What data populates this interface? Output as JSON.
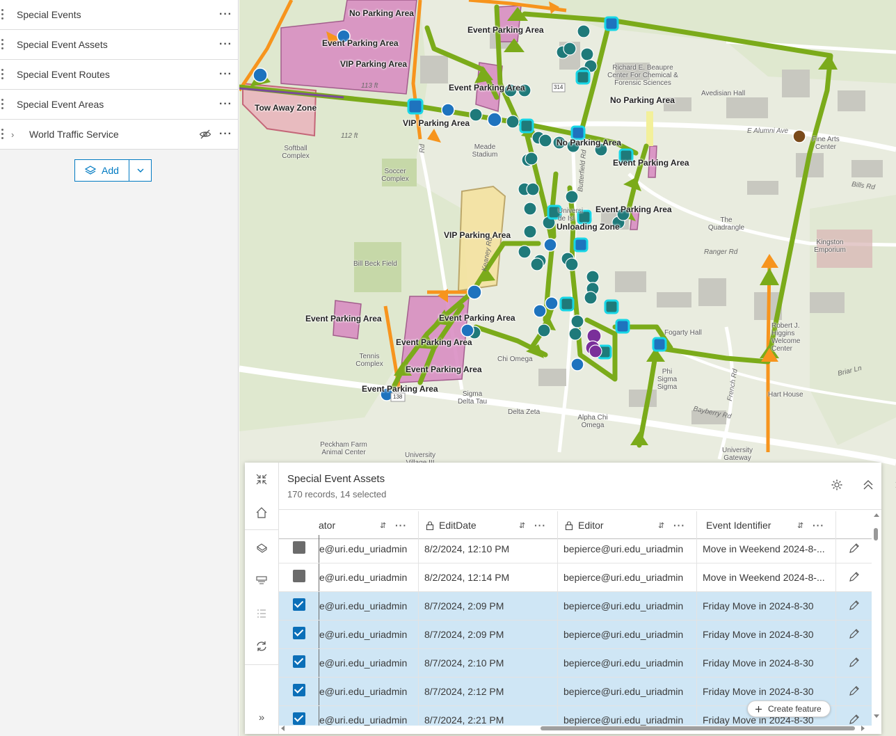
{
  "layers": {
    "items": [
      {
        "label": "Special Events"
      },
      {
        "label": "Special Event Assets"
      },
      {
        "label": "Special Event Routes"
      },
      {
        "label": "Special Event Areas"
      },
      {
        "label": "World Traffic Service",
        "hidden": true
      }
    ],
    "add_label": "Add"
  },
  "map": {
    "area_labels": [
      "No Parking Area",
      "Event Parking Area",
      "VIP Parking Area",
      "Event Parking Area",
      "Tow Away Zone",
      "VIP Parking Area",
      "No Parking Area",
      "No Parking Area",
      "Event Parking Area",
      "Event Parking Area",
      "Unloading Zone",
      "VIP Parking Area",
      "Event Parking Area",
      "Event Parking Area",
      "Event Parking Area",
      "Event Parking Area",
      "Event Parking Area",
      "Event Parking Area"
    ],
    "places": [
      "Softball Complex",
      "Meade Stadium",
      "Soccer Complex",
      "Bill Beck Field",
      "Tennis Complex",
      "Chi Omega",
      "Sigma Delta Tau",
      "Delta Zeta",
      "Alpha Chi Omega",
      "Peckham Farm Animal Center",
      "University Village III",
      "Richard E. Beaupre Center For Chemical & Forensic Sciences",
      "Avedisian Hall",
      "Fine Arts Center",
      "The Quadrangle",
      "Kingston Emporium",
      "Fogarty Hall",
      "Robert J. Higgins Welcome Center",
      "Phi Sigma Sigma",
      "Hart House",
      "University Gateway",
      "Universi de Isl"
    ],
    "roads": [
      "E Alumni Ave",
      "Bills Rd",
      "Ranger Rd",
      "Briar Ln",
      "Bayberry Rd",
      "French Rd",
      "Butterfield Rd",
      "Keaney Rd"
    ],
    "elevations": [
      "113 ft",
      "112 ft"
    ],
    "shields": [
      "314",
      "138",
      "Rd"
    ]
  },
  "table": {
    "title": "Special Event Assets",
    "subtitle": "170 records, 14 selected",
    "columns": [
      {
        "label": "ator",
        "locked": false
      },
      {
        "label": "EditDate",
        "locked": true
      },
      {
        "label": "Editor",
        "locked": true
      },
      {
        "label": "Event Identifier",
        "locked": false
      }
    ],
    "rows": [
      {
        "selected": false,
        "creator": "e@uri.edu_uriadmin",
        "edit_date": "8/2/2024, 12:10 PM",
        "editor": "bepierce@uri.edu_uriadmin",
        "event": "Move in Weekend 2024-8-..."
      },
      {
        "selected": false,
        "creator": "e@uri.edu_uriadmin",
        "edit_date": "8/2/2024, 12:14 PM",
        "editor": "bepierce@uri.edu_uriadmin",
        "event": "Move in Weekend 2024-8-..."
      },
      {
        "selected": true,
        "creator": "e@uri.edu_uriadmin",
        "edit_date": "8/7/2024, 2:09 PM",
        "editor": "bepierce@uri.edu_uriadmin",
        "event": "Friday Move in 2024-8-30"
      },
      {
        "selected": true,
        "creator": "e@uri.edu_uriadmin",
        "edit_date": "8/7/2024, 2:09 PM",
        "editor": "bepierce@uri.edu_uriadmin",
        "event": "Friday Move in 2024-8-30"
      },
      {
        "selected": true,
        "creator": "e@uri.edu_uriadmin",
        "edit_date": "8/7/2024, 2:10 PM",
        "editor": "bepierce@uri.edu_uriadmin",
        "event": "Friday Move in 2024-8-30"
      },
      {
        "selected": true,
        "creator": "e@uri.edu_uriadmin",
        "edit_date": "8/7/2024, 2:12 PM",
        "editor": "bepierce@uri.edu_uriadmin",
        "event": "Friday Move in 2024-8-30"
      },
      {
        "selected": true,
        "creator": "e@uri.edu_uriadmin",
        "edit_date": "8/7/2024, 2:21 PM",
        "editor": "bepierce@uri.edu_uriadmin",
        "event": "Friday Move in 2024-8-30"
      }
    ],
    "create_feature_label": "Create feature"
  },
  "colors": {
    "accent": "#007ac2",
    "route_green": "#7bab1a",
    "route_orange": "#f7941d",
    "parking_pink": "#d98cc2",
    "vip_yellow": "#f5e3a0",
    "asset_teal": "#1f7a7a",
    "selected_row": "#cfe6f5"
  }
}
